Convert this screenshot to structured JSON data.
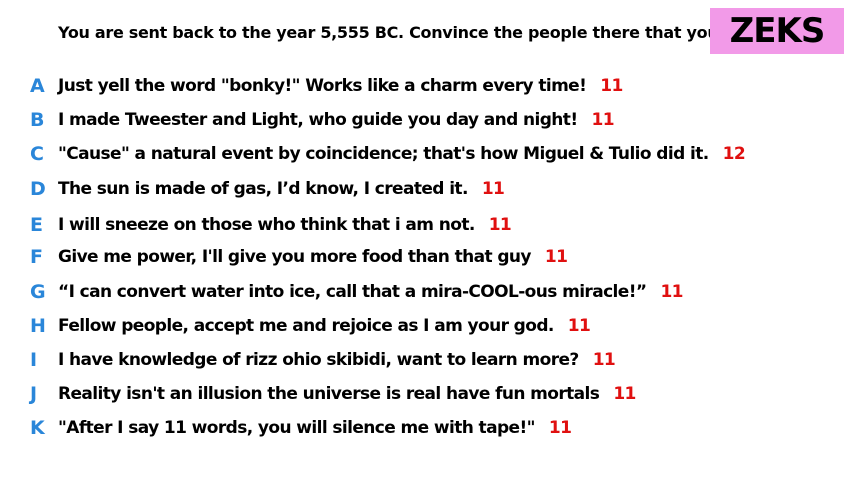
{
  "header": {
    "prompt": "You are sent back to the year 5,555 BC. Convince the people there that you're a god.",
    "player_name": "ZEKS"
  },
  "colors": {
    "badge_bg": "#f29ae8",
    "letter": "#2a86d9",
    "count": "#e01010",
    "text": "#000000",
    "background": "#ffffff"
  },
  "answers": [
    {
      "letter": "A",
      "text": "Just yell the word \"bonky!\" Works like a charm every time!",
      "count": "11"
    },
    {
      "letter": "B",
      "text": "I made Tweester and Light, who guide you day and night!",
      "count": "11"
    },
    {
      "letter": "C",
      "text": "\"Cause\" a natural event by coincidence; that's how Miguel & Tulio did it.",
      "count": "12"
    },
    {
      "letter": "D",
      "text": "The sun is made of gas, I’d know, I created it.",
      "count": "11"
    },
    {
      "letter": "E",
      "text": "I will sneeze on those who think that i am not.",
      "count": "11"
    },
    {
      "letter": "F",
      "text": "Give me power, I'll give you more food than that guy",
      "count": "11"
    },
    {
      "letter": "G",
      "text": "“I can convert water into ice, call that a mira-COOL-ous miracle!”",
      "count": "11"
    },
    {
      "letter": "H",
      "text": "Fellow people, accept me and rejoice as I am your god.",
      "count": "11"
    },
    {
      "letter": "I",
      "text": "I have knowledge of rizz ohio skibidi, want to learn more?",
      "count": "11"
    },
    {
      "letter": "J",
      "text": "Reality isn't an illusion the universe is real have fun mortals",
      "count": "11"
    },
    {
      "letter": "K",
      "text": "\"After I say 11 words, you will silence me with tape!\"",
      "count": "11"
    }
  ]
}
